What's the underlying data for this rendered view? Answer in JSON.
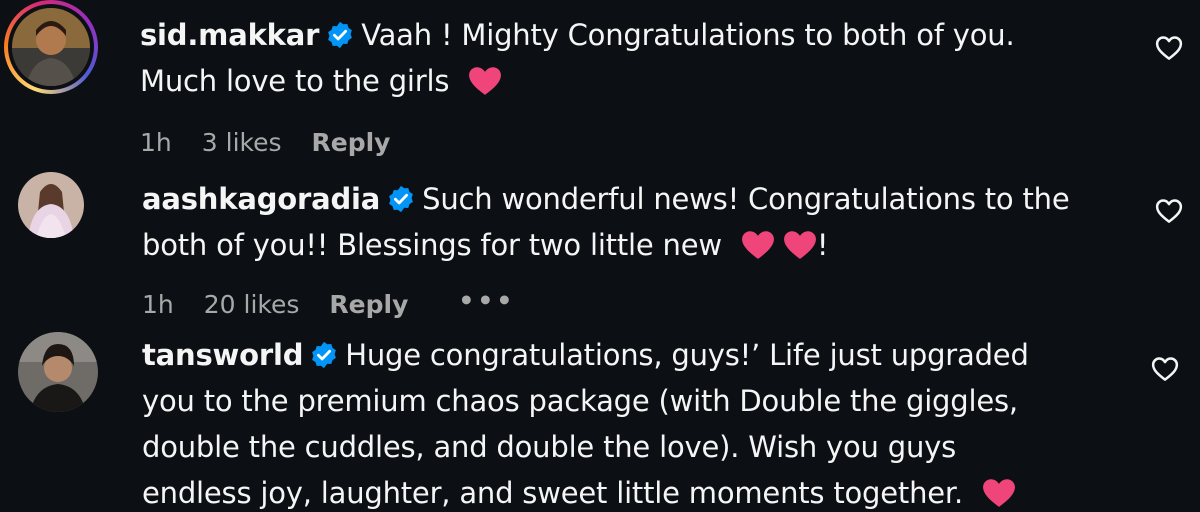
{
  "comments": [
    {
      "username": "sid.makkar",
      "text_lines": [
        "Vaah ! Mighty Congratulations to both of you.",
        "Much love to the girls"
      ],
      "time": "1h",
      "likes": "3 likes",
      "reply_label": "Reply",
      "has_story_ring": true
    },
    {
      "username": "aashkagoradia",
      "text_lines": [
        "Such wonderful news! Congratulations to the",
        "both of you!! Blessings for two little new"
      ],
      "text_suffix": "!",
      "time": "1h",
      "likes": "20 likes",
      "reply_label": "Reply",
      "more_label": "•••"
    },
    {
      "username": "tansworld",
      "text_lines": [
        "Huge congratulations, guys!’ Life just upgraded",
        "you to the premium chaos package (with Double the giggles,",
        "double the cuddles, and double the love). Wish you guys",
        "endless joy, laughter, and sweet little moments together."
      ]
    }
  ],
  "colors": {
    "background": "#0c1014",
    "text": "#f5f5f5",
    "meta": "#a8a8a8",
    "verified": "#0095f6",
    "heart_emoji": "#f0457a"
  },
  "icons": {
    "verified": "verified-badge-icon",
    "like": "heart-outline-icon",
    "emoji": "pink-heart-emoji"
  }
}
